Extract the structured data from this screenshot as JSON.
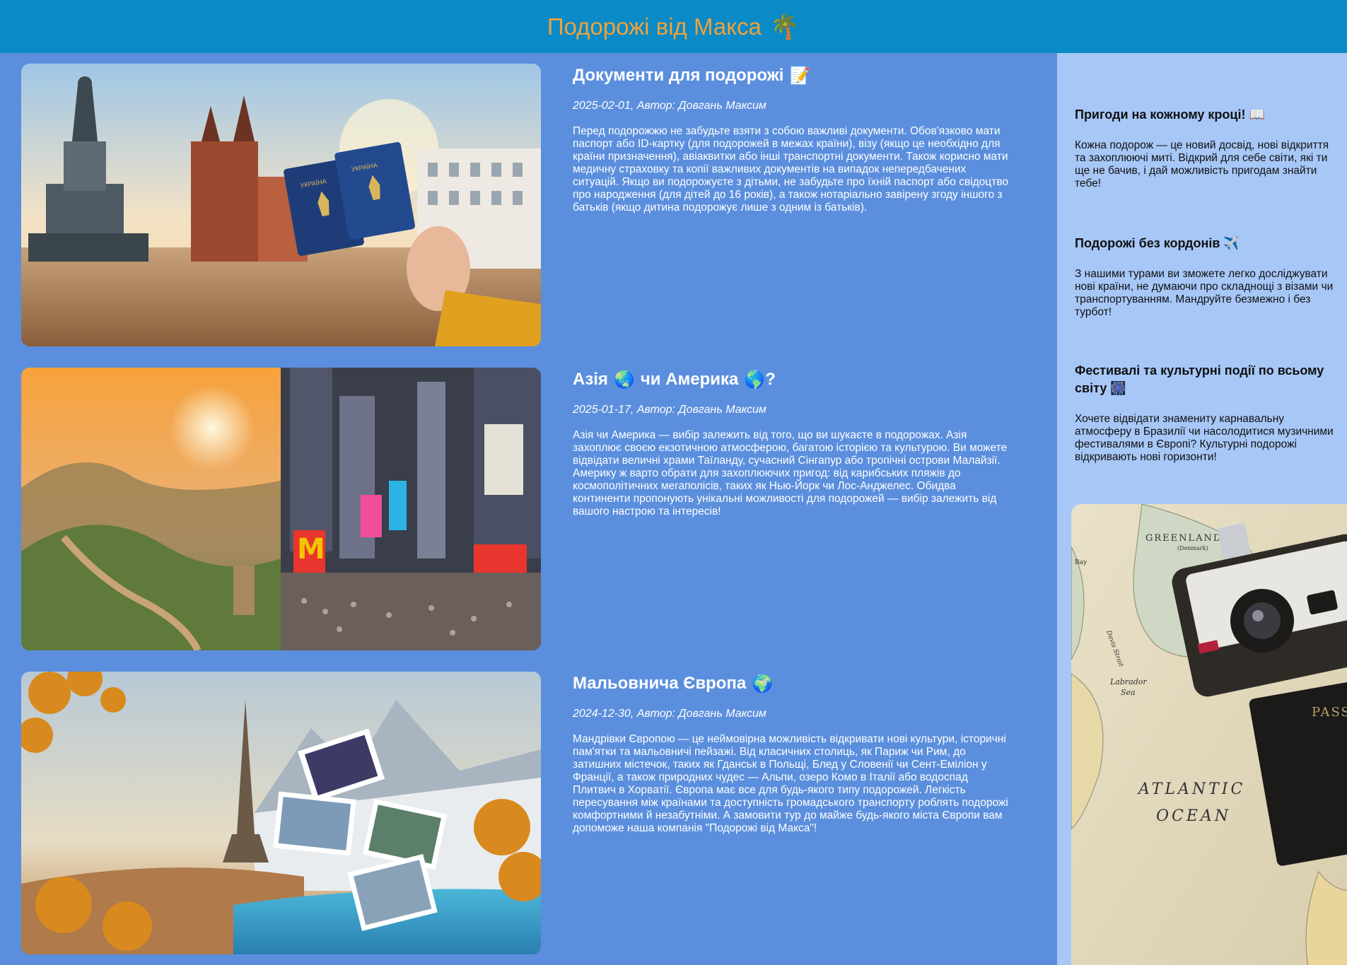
{
  "header": {
    "title": "Подорожі від Макса",
    "icon": "palm-tree-icon",
    "accent_color": "#f0a23a",
    "bar_color": "#0a8ac6"
  },
  "posts": [
    {
      "title": "Документи для подорожі",
      "title_icon": "memo-icon",
      "meta": "2025-02-01, Автор: Довгань Максим",
      "text": "Перед подорожжю не забудьте взяти з собою важливі документи. Обов'язково мати паспорт або ID-картку (для подорожей в межах країни), візу (якщо це необхідно для країни призначення), авіаквитки або інші транспортні документи. Також корисно мати медичну страховку та копії важливих документів на випадок непередбачених ситуацій. Якщо ви подорожуєте з дітьми, не забудьте про їхній паспорт або свідоцтво про народження (для дітей до 16 років), а також нотаріально завірену згоду іншого з батьків (якщо дитина подорожує лише з одним із батьків).",
      "image": "krakow-square-passports-photo"
    },
    {
      "title_part1": "Азія",
      "title_part2": "чи Америка",
      "title_part3": "?",
      "title_icon": "globe-icon",
      "meta": "2025-01-17, Автор: Довгань Максим",
      "text": "Азія чи Америка — вибір залежить від того, що ви шукаєте в подорожах. Азія захоплює своєю екзотичною атмосферою, багатою історією та культурою. Ви можете відвідати величні храми Таїланду, сучасний Сінгапур або тропічні острови Малайзії. Америку ж варто обрати для захоплюючих пригод: від карибських пляжів до космополітичних мегаполісів, таких як Нью-Йорк чи Лос-Анджелес. Обидва континенти пропонують унікальні можливості для подорожей — вибір залежить від вашого настрою та інтересів!",
      "image": "great-wall-and-times-square-photo"
    },
    {
      "title": "Мальовнича Європа",
      "title_icon": "globe-icon",
      "meta": "2024-12-30, Автор: Довгань Максим",
      "text": "Мандрівки Європою — це неймовірна можливість відкривати нові культури, історичні пам'ятки та мальовничі пейзажі. Від класичних столиць, як Париж чи Рим, до затишних містечок, таких як Гданськ в Польщі, Блед у Словенії чи Сент-Еміліон у Франції, а також природних чудес — Альпи, озеро Комо в Італії або водоспад Плитвич в Хорватії. Європа має все для будь-якого типу подорожей. Легкість пересування між країнами та доступність громадського транспорту роблять подорожі комфортними й незабутніми. А замовити тур до майже будь-якого міста Європи вам допоможе наша компанія \"Подорожі від Макса\"!",
      "image": "europe-eiffel-collage-photo"
    }
  ],
  "sidebar": {
    "promos": [
      {
        "title": "Пригоди на кожному кроці!",
        "icon": "book-icon",
        "text": "Кожна подорож — це новий досвід, нові відкриття та захоплюючі миті. Відкрий для себе світи, які ти ще не бачив, і дай можливість пригодам знайти тебе!"
      },
      {
        "title": "Подорожі без кордонів",
        "icon": "airplane-icon",
        "text": "З нашими турами ви зможете легко досліджувати нові країни, не думаючи про складнощі з візами чи транспортуванням. Мандруйте безмежно і без турбот!"
      },
      {
        "title": "Фестивалі та культурні події по всьому світу",
        "icon": "fireworks-icon",
        "text": "Хочете відвідати знамениту карнавальну атмосферу в Бразилії чи насолодитися музичними фестивалями в Європі? Культурні подорожі відкривають нові горизонти!"
      }
    ],
    "map_labels": {
      "greenland": "GREENLAND",
      "denmark": "(Denmark)",
      "atlantic": "ATLANTIC",
      "ocean": "OCEAN",
      "labrador": "Labrador",
      "sea": "Sea",
      "bay": "Bay",
      "davis": "Davis Strait",
      "passport": "PASS"
    },
    "image": "map-camera-passport-photo"
  },
  "colors": {
    "main_bg": "#5b8fdd",
    "sidebar_bg": "#a7c7f7"
  }
}
